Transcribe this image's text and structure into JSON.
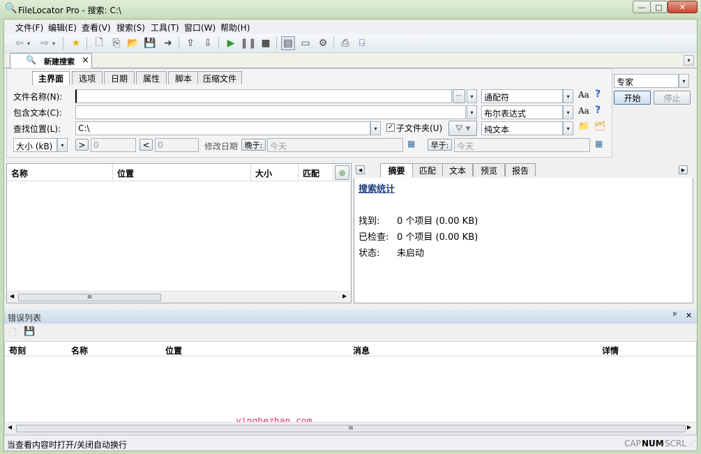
{
  "window": {
    "title": "FileLocator Pro - 搜索: C:\\",
    "minimize": "—",
    "maximize": "□",
    "close": "✕"
  },
  "menu": [
    "文件(F)",
    "编辑(E)",
    "查看(V)",
    "搜索(S)",
    "工具(T)",
    "窗口(W)",
    "帮助(H)"
  ],
  "doc_tab": {
    "label": "新建搜索",
    "close": "×"
  },
  "search_tabs": [
    "主界面",
    "选项",
    "日期",
    "属性",
    "脚本",
    "压缩文件"
  ],
  "form": {
    "filename_label": "文件名称(N):",
    "filename_value": "",
    "browse_btn": "···",
    "filename_mode": "通配符",
    "contains_label": "包含文本(C):",
    "contains_value": "",
    "contains_mode": "布尔表达式",
    "location_label": "查找位置(L):",
    "location_value": "C:\\",
    "subfolders_label": "子文件夹(U)",
    "location_mode": "纯文本",
    "size_unit": "大小 (kB)",
    "gt": ">",
    "gt_value": "0",
    "lt": "<",
    "lt_value": "0",
    "date_label": "修改日期",
    "after_btn": "晚于:",
    "after_value": "今天",
    "before_btn": "早于:",
    "before_value": "今天",
    "case_icon": "Aa",
    "help_icon": "?"
  },
  "mode_select": "专家",
  "start_btn": "开始",
  "stop_btn": "停止",
  "results_columns": [
    "名称",
    "位置",
    "大小",
    "匹配"
  ],
  "right_tabs": [
    "摘要",
    "匹配",
    "文本",
    "预览",
    "报告"
  ],
  "summary": {
    "title": "搜索统计",
    "found_label": "找到:",
    "found_value": "0 个项目 (0.00 KB)",
    "checked_label": "已检查:",
    "checked_value": "0 个项目 (0.00 KB)",
    "status_label": "状态:",
    "status_value": "未启动"
  },
  "error_list": {
    "title": "错误列表",
    "columns": [
      "苟刻",
      "名称",
      "位置",
      "消息",
      "详情"
    ],
    "pin": "ᵖ",
    "close": "✕"
  },
  "scroll_thumb": "III",
  "watermark": "yinghezhan.com",
  "status": {
    "text": "当查看内容时打开/关闭自动换行",
    "cap": "CAP",
    "num": "NUM",
    "scrl": "SCRL"
  }
}
